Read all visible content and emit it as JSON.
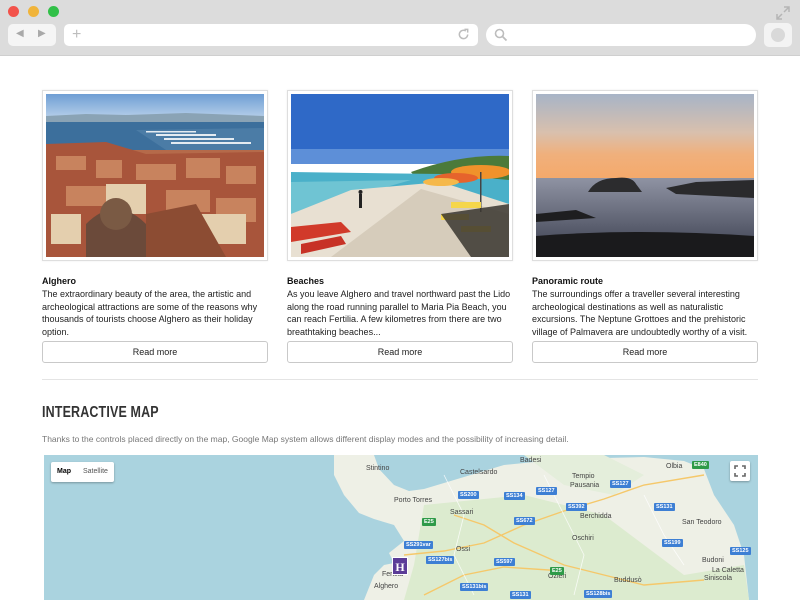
{
  "browser": {
    "back_icon": "◀",
    "forward_icon": "▶",
    "new_tab_icon": "+"
  },
  "cards": [
    {
      "title": "Alghero",
      "text": "The extraordinary beauty of the area, the artistic and archeological attractions are some of the reasons why thousands of tourists choose Alghero as their holiday option.",
      "button": "Read more"
    },
    {
      "title": "Beaches",
      "text": "As you leave Alghero and travel northward past the Lido along the road running parallel to Maria Pia Beach, you can reach Fertilia. A few kilometres from there are two breathtaking beaches...",
      "button": "Read more"
    },
    {
      "title": "Panoramic route",
      "text": "The surroundings offer a traveller several interesting archeological destinations as well as naturalistic excursions. The Neptune Grottoes and the prehistoric village of Palmavera are undoubtedly worthy of a visit.",
      "button": "Read more"
    }
  ],
  "map_section": {
    "title": "INTERACTIVE MAP",
    "description": "Thanks to the controls placed directly on the map, Google Map system allows different display modes and the possibility of increasing detail.",
    "toggle": {
      "map": "Map",
      "satellite": "Satellite"
    },
    "marker": "H",
    "places": {
      "stintino": "Stintino",
      "badesi": "Badesi",
      "castelsardo": "Castelsardo",
      "olbia": "Olbia",
      "tempio": "Tempio",
      "pausania": "Pausania",
      "porto_torres": "Porto Torres",
      "sassari": "Sassari",
      "berchidda": "Berchidda",
      "san_teodoro": "San Teodoro",
      "ossi": "Ossi",
      "oschiri": "Oschiri",
      "budoni": "Budoni",
      "ozieri": "Ozieri",
      "budduso": "Buddusò",
      "siniscola": "Siniscola",
      "la_caletta": "La Caletta",
      "fertilia": "Fertilia",
      "alghero": "Alghero"
    },
    "roads": {
      "e840": "E840",
      "ss200": "SS200",
      "ss134": "SS134",
      "ss127": "SS127",
      "ss127b": "SS127",
      "ss392": "SS392",
      "ss131": "SS131",
      "ss672": "SS672",
      "ss291var": "SS291var",
      "ss597": "SS597",
      "ss127bis": "SS127bis",
      "ss131bis": "SS131bis",
      "ss199": "SS199",
      "ss128bis": "SS128bis",
      "ss125": "SS125",
      "e25": "E25",
      "e25b": "E25",
      "ss131c": "SS131"
    }
  }
}
